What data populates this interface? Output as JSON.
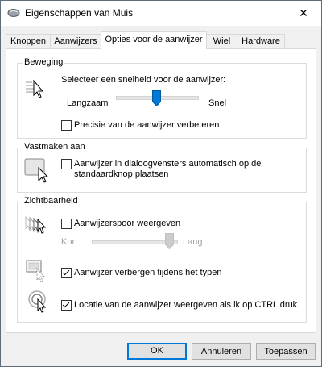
{
  "window": {
    "title": "Eigenschappen van Muis",
    "close_label": "✕"
  },
  "tabs": [
    {
      "label": "Knoppen"
    },
    {
      "label": "Aanwijzers"
    },
    {
      "label": "Opties voor de aanwijzer",
      "active": true
    },
    {
      "label": "Wiel"
    },
    {
      "label": "Hardware"
    }
  ],
  "motion": {
    "legend": "Beweging",
    "prompt": "Selecteer een snelheid voor de aanwijzer:",
    "slow_label": "Langzaam",
    "fast_label": "Snel",
    "speed_level": 0.5,
    "precision_label": "Precisie van de aanwijzer verbeteren",
    "precision_checked": false
  },
  "snap": {
    "legend": "Vastmaken aan",
    "label_line1": "Aanwijzer in dialoogvensters automatisch op de",
    "label_line2": "standaardknop plaatsen",
    "checked": false
  },
  "visibility": {
    "legend": "Zichtbaarheid",
    "trails_label": "Aanwijzerspoor weergeven",
    "trails_checked": false,
    "short_label": "Kort",
    "long_label": "Lang",
    "trail_level": 1.0,
    "hide_label": "Aanwijzer verbergen tijdens het typen",
    "hide_checked": true,
    "ctrl_label": "Locatie van de aanwijzer weergeven als ik op CTRL druk",
    "ctrl_checked": true
  },
  "buttons": {
    "ok": "OK",
    "cancel": "Annuleren",
    "apply": "Toepassen"
  }
}
